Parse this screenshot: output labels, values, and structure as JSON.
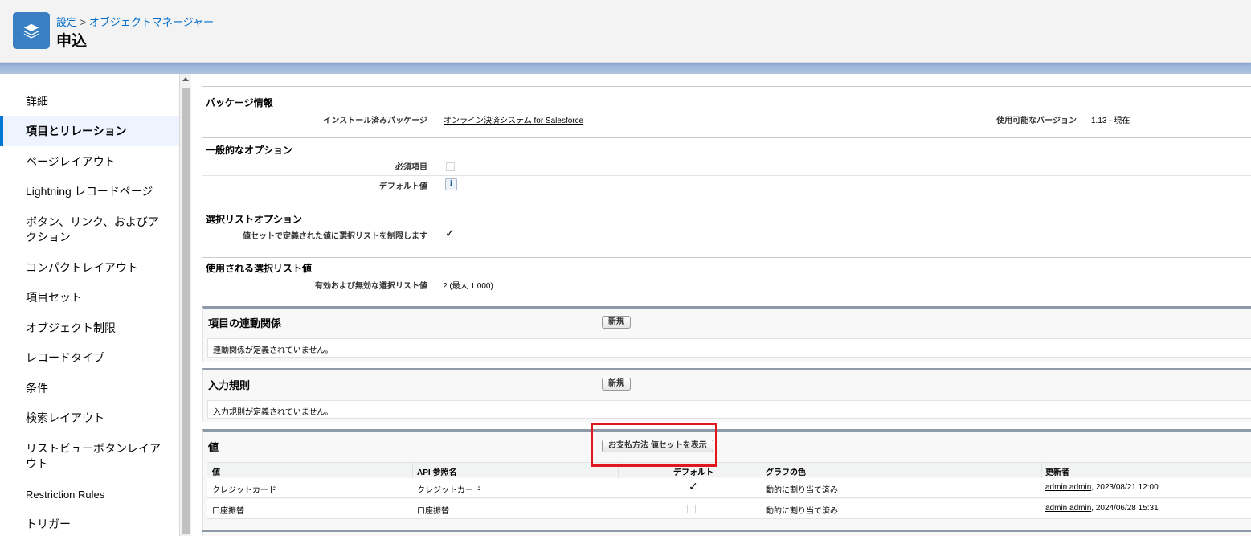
{
  "header": {
    "breadcrumb_setup": "設定",
    "breadcrumb_sep": ">",
    "breadcrumb_object_manager": "オブジェクトマネージャー",
    "title": "申込",
    "icon": "layers-icon"
  },
  "sidebar": {
    "items": [
      {
        "label": "詳細"
      },
      {
        "label": "項目とリレーション"
      },
      {
        "label": "ページレイアウト"
      },
      {
        "label": "Lightning レコードページ"
      },
      {
        "label": "ボタン、リンク、およびアクション"
      },
      {
        "label": "コンパクトレイアウト"
      },
      {
        "label": "項目セット"
      },
      {
        "label": "オブジェクト制限"
      },
      {
        "label": "レコードタイプ"
      },
      {
        "label": "条件"
      },
      {
        "label": "検索レイアウト"
      },
      {
        "label": "リストビューボタンレイアウト"
      },
      {
        "label": "Restriction Rules"
      },
      {
        "label": "トリガー"
      }
    ]
  },
  "package": {
    "title": "パッケージ情報",
    "installed_label": "インストール済みパッケージ",
    "installed_value": "オンライン決済システム for Salesforce",
    "version_label": "使用可能なバージョン",
    "version_value": "1.13 - 現在"
  },
  "general": {
    "title": "一般的なオプション",
    "required_label": "必須項目",
    "default_label": "デフォルト値",
    "info_glyph": "i"
  },
  "picklist_options": {
    "title": "選択リストオプション",
    "restrict_label": "値セットで定義された値に選択リストを制限します",
    "check_glyph": "✓"
  },
  "picklist_values": {
    "title": "使用される選択リスト値",
    "count_label": "有効および無効な選択リスト値",
    "count_value": "2 (最大 1,000)"
  },
  "dependencies": {
    "title": "項目の連動関係",
    "new_button": "新規",
    "empty": "連動関係が定義されていません。"
  },
  "validation": {
    "title": "入力規則",
    "new_button": "新規",
    "empty": "入力規則が定義されていません。"
  },
  "values": {
    "title": "値",
    "show_valueset_button": "お支払方法 値セットを表示",
    "columns": [
      "値",
      "API 参照名",
      "デフォルト",
      "グラフの色",
      "更新者"
    ],
    "rows": [
      {
        "value": "クレジットカード",
        "api": "クレジットカード",
        "default": "✓",
        "color": "動的に割り当て済み",
        "updated_by": "admin admin",
        "updated_at": ", 2023/08/21 12:00"
      },
      {
        "value": "口座振替",
        "api": "口座振替",
        "default": "",
        "color": "動的に割り当て済み",
        "updated_by": "admin admin",
        "updated_at": ", 2024/06/28 15:31"
      }
    ]
  },
  "colors": {
    "brand": "#3a7fc1",
    "link": "#006dcc",
    "highlight": "#e0171d"
  }
}
